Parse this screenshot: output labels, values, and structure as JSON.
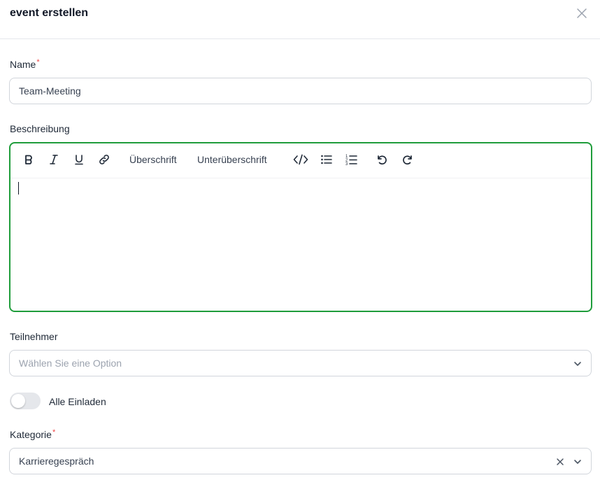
{
  "dialog": {
    "title": "event erstellen"
  },
  "form": {
    "name": {
      "label": "Name",
      "required_mark": "*",
      "value": "Team-Meeting"
    },
    "beschreibung": {
      "label": "Beschreibung",
      "toolbar": {
        "bold_icon": "bold-icon",
        "italic_icon": "italic-icon",
        "underline_icon": "underline-icon",
        "link_icon": "link-icon",
        "heading_label": "Überschrift",
        "subheading_label": "Unterüberschrift",
        "code_icon": "code-icon",
        "bullet_list_icon": "bullet-list-icon",
        "ordered_list_icon": "ordered-list-icon",
        "undo_icon": "undo-icon",
        "redo_icon": "redo-icon"
      },
      "value": ""
    },
    "teilnehmer": {
      "label": "Teilnehmer",
      "placeholder": "Wählen Sie eine Option"
    },
    "alle_einladen": {
      "label": "Alle Einladen",
      "checked": false
    },
    "kategorie": {
      "label": "Kategorie",
      "required_mark": "*",
      "value": "Karrieregespräch"
    }
  },
  "colors": {
    "focus_border": "#1f9d3b",
    "required": "#ef4444"
  }
}
